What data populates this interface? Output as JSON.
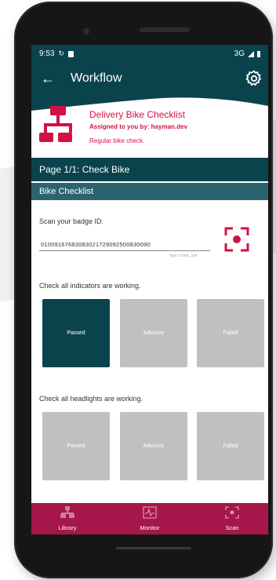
{
  "status_bar": {
    "time": "9:53",
    "network": "3G"
  },
  "app_bar": {
    "title": "Workflow"
  },
  "header_card": {
    "title": "Delivery Bike Checklist",
    "assigned": "Assigned to you by: hayman.dev",
    "description": "Regular bike check."
  },
  "page_title": "Page 1/1: Check Bike",
  "section_title": "Bike Checklist",
  "badge": {
    "label": "Scan your badge ID.",
    "value": "01009167683083021729092500830090",
    "type": "Type: CODE_128"
  },
  "questions": [
    {
      "label": "Check all indicators are working.",
      "options": [
        "Passed",
        "Advisory",
        "Failed"
      ],
      "selected": "Passed"
    },
    {
      "label": "Check all headlights are working.",
      "options": [
        "Passed",
        "Advisory",
        "Failed"
      ],
      "selected": null
    }
  ],
  "bottom_nav": [
    {
      "label": "Library",
      "icon": "library-icon"
    },
    {
      "label": "Monitor",
      "icon": "monitor-icon"
    },
    {
      "label": "Scan",
      "icon": "scan-icon"
    }
  ],
  "colors": {
    "primary": "#0b434c",
    "accent": "#d11344",
    "nav": "#a5174b",
    "option_selected": "#0b434c",
    "option_idle": "#c0c0c0"
  }
}
